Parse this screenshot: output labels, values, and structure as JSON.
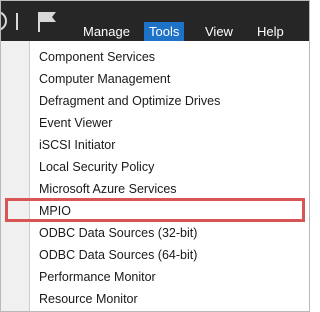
{
  "menubar": {
    "items": [
      {
        "label": "Manage"
      },
      {
        "label": "Tools",
        "active": true
      },
      {
        "label": "View"
      },
      {
        "label": "Help"
      }
    ],
    "icons": [
      "back-circle-icon",
      "flag-icon"
    ]
  },
  "tools_menu": {
    "items": [
      {
        "label": "Component Services"
      },
      {
        "label": "Computer Management"
      },
      {
        "label": "Defragment and Optimize Drives"
      },
      {
        "label": "Event Viewer"
      },
      {
        "label": "iSCSI Initiator"
      },
      {
        "label": "Local Security Policy"
      },
      {
        "label": "Microsoft Azure Services"
      },
      {
        "label": "MPIO",
        "highlighted": true
      },
      {
        "label": "ODBC Data Sources (32-bit)"
      },
      {
        "label": "ODBC Data Sources (64-bit)"
      },
      {
        "label": "Performance Monitor"
      },
      {
        "label": "Resource Monitor"
      }
    ]
  },
  "colors": {
    "menubar_bg": "#262626",
    "active_tab": "#1e73c8",
    "highlight_border": "#d95555"
  }
}
